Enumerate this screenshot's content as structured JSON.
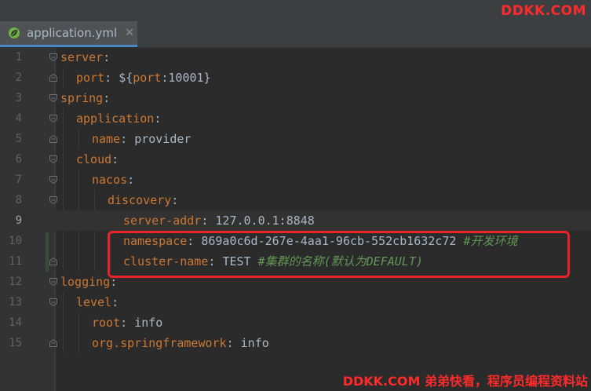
{
  "watermark_top": "DDKK.COM",
  "watermark_bottom": "DDKK.COM 弟弟快看，程序员编程资料站",
  "tab": {
    "filename": "application.yml",
    "close_glyph": "✕",
    "icon": "spring-leaf-icon"
  },
  "current_line": 9,
  "lines": [
    {
      "n": "1",
      "indent": 0,
      "key": "server",
      "sep": ":",
      "val": "",
      "comment": "",
      "fold": "open"
    },
    {
      "n": "2",
      "indent": 1,
      "key": "port",
      "sep": ": ",
      "val": "${",
      "val_key": "port",
      "val2": ":10001}",
      "comment": "",
      "fold": "close"
    },
    {
      "n": "3",
      "indent": 0,
      "key": "spring",
      "sep": ":",
      "val": "",
      "comment": "",
      "fold": "open"
    },
    {
      "n": "4",
      "indent": 1,
      "key": "application",
      "sep": ":",
      "val": "",
      "comment": "",
      "fold": "open"
    },
    {
      "n": "5",
      "indent": 2,
      "key": "name",
      "sep": ": ",
      "val": "provider",
      "comment": "",
      "fold": "close"
    },
    {
      "n": "6",
      "indent": 1,
      "key": "cloud",
      "sep": ":",
      "val": "",
      "comment": "",
      "fold": "open"
    },
    {
      "n": "7",
      "indent": 2,
      "key": "nacos",
      "sep": ":",
      "val": "",
      "comment": "",
      "fold": "open"
    },
    {
      "n": "8",
      "indent": 3,
      "key": "discovery",
      "sep": ":",
      "val": "",
      "comment": "",
      "fold": "open"
    },
    {
      "n": "9",
      "indent": 4,
      "key": "server-addr",
      "sep": ": ",
      "val": "127.0.0.1:8848",
      "comment": "",
      "fold": ""
    },
    {
      "n": "10",
      "indent": 4,
      "key": "namespace",
      "sep": ": ",
      "val": "869a0c6d-267e-4aa1-96cb-552cb1632c72 ",
      "comment": "#开发环境",
      "fold": ""
    },
    {
      "n": "11",
      "indent": 4,
      "key": "cluster-name",
      "sep": ": ",
      "val": "TEST ",
      "comment": "#集群的名称(默认为DEFAULT)",
      "fold": "close"
    },
    {
      "n": "12",
      "indent": 0,
      "key": "logging",
      "sep": ":",
      "val": "",
      "comment": "",
      "fold": "open"
    },
    {
      "n": "13",
      "indent": 1,
      "key": "level",
      "sep": ":",
      "val": "",
      "comment": "",
      "fold": "open"
    },
    {
      "n": "14",
      "indent": 2,
      "key": "root",
      "sep": ": ",
      "val": "info",
      "comment": "",
      "fold": ""
    },
    {
      "n": "15",
      "indent": 2,
      "key": "org.springframework",
      "sep": ": ",
      "val": "info",
      "comment": "",
      "fold": "close"
    }
  ]
}
